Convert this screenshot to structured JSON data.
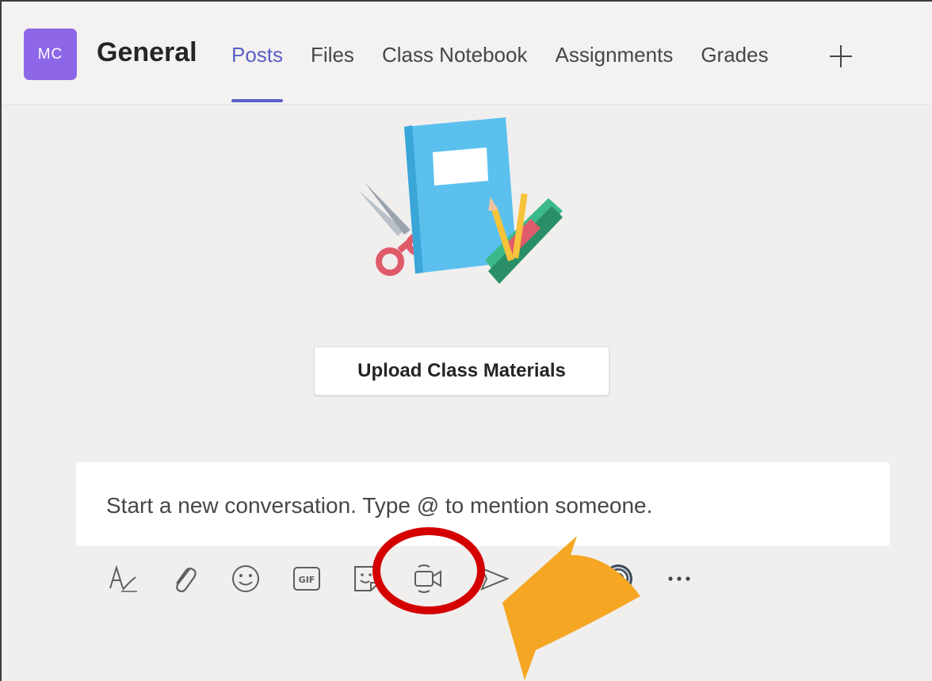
{
  "team": {
    "avatar_initials": "MC",
    "channel_name": "General"
  },
  "tabs": [
    {
      "label": "Posts",
      "active": true
    },
    {
      "label": "Files",
      "active": false
    },
    {
      "label": "Class Notebook",
      "active": false
    },
    {
      "label": "Assignments",
      "active": false
    },
    {
      "label": "Grades",
      "active": false
    }
  ],
  "upload_button": {
    "label": "Upload Class Materials"
  },
  "compose": {
    "placeholder": "Start a new conversation. Type @ to mention someone."
  },
  "toolbar": {
    "icons": [
      "format-icon",
      "attach-icon",
      "emoji-icon",
      "gif-icon",
      "sticker-icon",
      "meet-now-icon",
      "send-icon",
      "search-icon",
      "loop-icon",
      "more-icon"
    ],
    "gif_label": "GIF"
  },
  "colors": {
    "accent": "#5b5fc7",
    "avatar": "#8e67e8",
    "highlight_circle": "#d40000",
    "arrow": "#f5a623"
  }
}
